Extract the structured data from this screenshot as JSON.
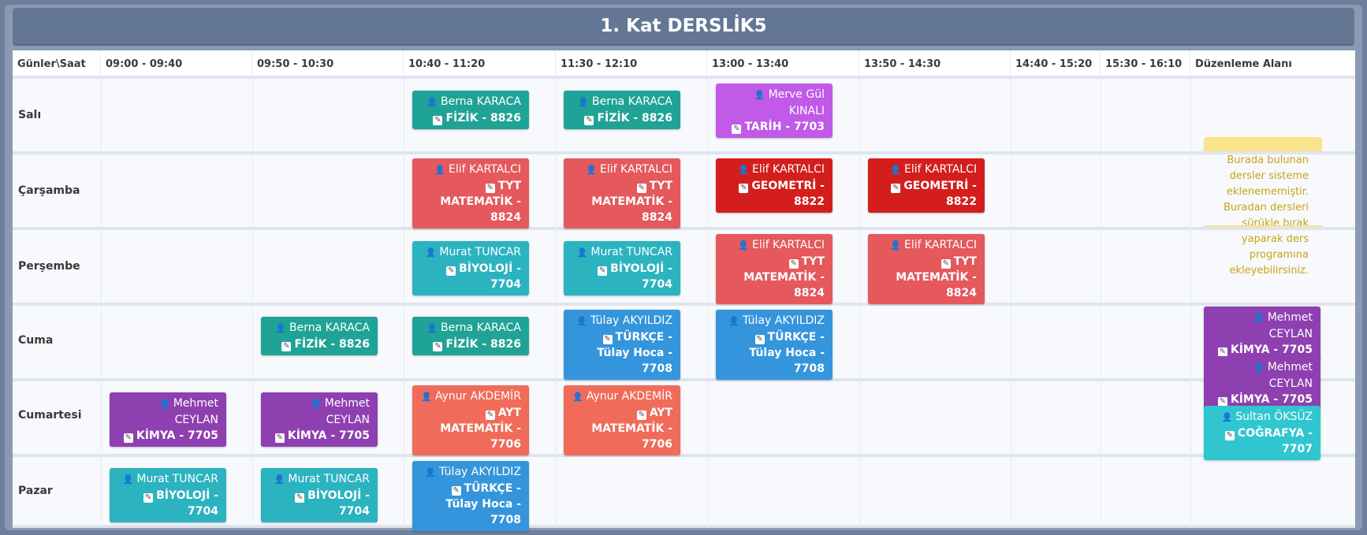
{
  "title": "1. Kat DERSLİK5",
  "headers": [
    "Günler\\Saat",
    "09:00 - 09:40",
    "09:50 - 10:30",
    "10:40 - 11:20",
    "11:30 - 12:10",
    "13:00 - 13:40",
    "13:50 - 14:30",
    "14:40 - 15:20",
    "15:30 - 16:10",
    "Düzenleme Alanı"
  ],
  "days": [
    "Salı",
    "Çarşamba",
    "Perşembe",
    "Cuma",
    "Cumartesi",
    "Pazar"
  ],
  "lessons": [
    {
      "teacher": "Berna KARACA",
      "course": "FİZİK - 8826"
    },
    {
      "teacher": "Berna KARACA",
      "course": "FİZİK - 8826"
    },
    {
      "teacher": "Merve Gül KINALI",
      "course": "TARİH - 7703"
    },
    {
      "teacher": "Elif KARTALCI",
      "course": "TYT MATEMATİK - 8824"
    },
    {
      "teacher": "Elif KARTALCI",
      "course": "TYT MATEMATİK - 8824"
    },
    {
      "teacher": "Elif KARTALCI",
      "course": "GEOMETRİ - 8822"
    },
    {
      "teacher": "Elif KARTALCI",
      "course": "GEOMETRİ - 8822"
    },
    {
      "teacher": "Murat TUNCAR",
      "course": "BİYOLOJİ - 7704"
    },
    {
      "teacher": "Murat TUNCAR",
      "course": "BİYOLOJİ - 7704"
    },
    {
      "teacher": "Elif KARTALCI",
      "course": "TYT MATEMATİK - 8824"
    },
    {
      "teacher": "Elif KARTALCI",
      "course": "TYT MATEMATİK - 8824"
    },
    {
      "teacher": "Berna KARACA",
      "course": "FİZİK - 8826"
    },
    {
      "teacher": "Berna KARACA",
      "course": "FİZİK - 8826"
    },
    {
      "teacher": "Tülay AKYILDIZ",
      "course": "TÜRKÇE - Tülay Hoca - 7708"
    },
    {
      "teacher": "Tülay AKYILDIZ",
      "course": "TÜRKÇE - Tülay Hoca - 7708"
    },
    {
      "teacher": "Mehmet CEYLAN",
      "course": "KİMYA - 7705"
    },
    {
      "teacher": "Mehmet CEYLAN",
      "course": "KİMYA - 7705"
    },
    {
      "teacher": "Aynur AKDEMİR",
      "course": "AYT MATEMATİK - 7706"
    },
    {
      "teacher": "Aynur AKDEMİR",
      "course": "AYT MATEMATİK - 7706"
    },
    {
      "teacher": "Murat TUNCAR",
      "course": "BİYOLOJİ - 7704"
    },
    {
      "teacher": "Murat TUNCAR",
      "course": "BİYOLOJİ - 7704"
    },
    {
      "teacher": "Tülay AKYILDIZ",
      "course": "TÜRKÇE - Tülay Hoca - 7708"
    }
  ],
  "edit_area": {
    "hint": "Burada bulunan dersler sisteme eklenememiştir. Buradan dersleri sürükle bırak yaparak ders programına ekleyebilirsiniz.",
    "lessons": [
      {
        "teacher": "Mehmet CEYLAN",
        "course": "KİMYA - 7705"
      },
      {
        "teacher": "Mehmet CEYLAN",
        "course": "KİMYA - 7705"
      },
      {
        "teacher": "Sultan ÖKSÜZ",
        "course": "COĞRAFYA - 7707"
      }
    ]
  },
  "colors": {
    "teal": "#1fa396",
    "cyan": "#2bb3c0",
    "coral": "#e5585b",
    "red": "#d41e1e",
    "blue": "#3595dc",
    "purple": "#8e3fb0",
    "magenta": "#c05ae7",
    "salmon": "#f06b5a",
    "aqua": "#2fc6d0"
  }
}
